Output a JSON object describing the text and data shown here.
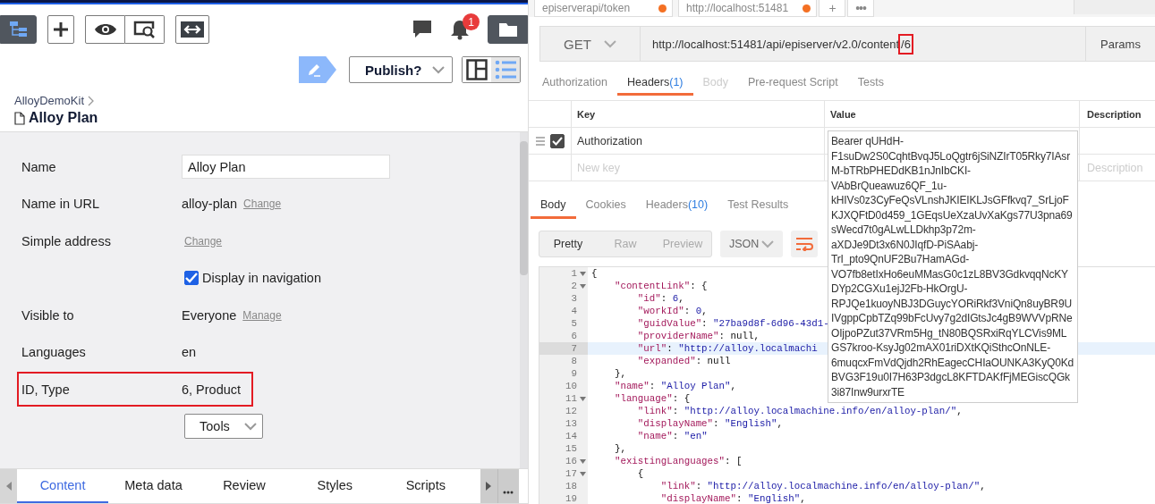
{
  "left": {
    "notification_count": "1",
    "publish_button": "Publish?",
    "view_toggle": [
      {
        "selected": false
      },
      {
        "selected": true
      }
    ],
    "breadcrumb": "AlloyDemoKit",
    "title": "Alloy Plan",
    "fields": [
      {
        "kind": "input",
        "label": "Name",
        "value": "Alloy Plan",
        "highlighted": false
      },
      {
        "kind": "text",
        "label": "Name in URL",
        "value": "alloy-plan",
        "link": "Change",
        "highlighted": false
      },
      {
        "kind": "text",
        "label": "Simple address",
        "link": "Change",
        "highlighted": false
      },
      {
        "kind": "checkbox",
        "value": "Display in navigation",
        "checked": true,
        "highlighted": false
      },
      {
        "kind": "text",
        "label": "Visible to",
        "value": "Everyone",
        "link": "Manage",
        "highlighted": false
      },
      {
        "kind": "text",
        "label": "Languages",
        "value": "en",
        "highlighted": false
      },
      {
        "kind": "text",
        "label": "ID, Type",
        "value": "6, Product",
        "highlighted": true
      },
      {
        "kind": "dropdown",
        "value": "Tools",
        "highlighted": false
      }
    ],
    "tabs": [
      {
        "label": "Content",
        "selected": true
      },
      {
        "label": "Meta data",
        "selected": false
      },
      {
        "label": "Review",
        "selected": false
      },
      {
        "label": "Styles",
        "selected": false
      },
      {
        "label": "Scripts",
        "selected": false
      }
    ]
  },
  "right": {
    "request_tabs": [
      {
        "label": "episerverapi/token",
        "unsaved": true
      },
      {
        "label": "http://localhost:51481",
        "unsaved": true
      }
    ],
    "add_tab": "+",
    "tab_menu": "•••",
    "method": "GET",
    "url": "http://localhost:51481/api/episerver/v2.0/content",
    "url_marked": "/6",
    "params_button": "Params",
    "request_sections": [
      {
        "label": "Authorization",
        "selected": false,
        "disabled": false
      },
      {
        "label": "Headers",
        "count": "(1)",
        "selected": true,
        "disabled": false
      },
      {
        "label": "Body",
        "selected": false,
        "disabled": true
      },
      {
        "label": "Pre-request Script",
        "selected": false,
        "disabled": false
      },
      {
        "label": "Tests",
        "selected": false,
        "disabled": false
      }
    ],
    "header_columns": [
      "Key",
      "Value",
      "Description"
    ],
    "headers": [
      {
        "key": "Authorization",
        "checked": true
      }
    ],
    "new_key_placeholder": "New key",
    "new_description_placeholder": "Description",
    "response_tabs": [
      {
        "label": "Body",
        "selected": true
      },
      {
        "label": "Cookies",
        "selected": false
      },
      {
        "label": "Headers",
        "count": "(10)",
        "selected": false
      },
      {
        "label": "Test Results",
        "selected": false
      }
    ],
    "view_modes": [
      {
        "label": "Pretty",
        "selected": true
      },
      {
        "label": "Raw",
        "selected": false
      },
      {
        "label": "Preview",
        "selected": false
      }
    ],
    "format": "JSON",
    "code_lines": [
      {
        "n": "1",
        "fold": true,
        "current": false,
        "segs": [
          {
            "kind": "punct",
            "text": "{"
          }
        ]
      },
      {
        "n": "2",
        "fold": true,
        "current": false,
        "segs": [
          {
            "kind": "key",
            "text": "    \"contentLink\""
          },
          {
            "kind": "punct",
            "text": ": {"
          }
        ]
      },
      {
        "n": "3",
        "fold": false,
        "current": false,
        "segs": [
          {
            "kind": "key",
            "text": "        \"id\""
          },
          {
            "kind": "punct",
            "text": ": "
          },
          {
            "kind": "number",
            "text": "6"
          },
          {
            "kind": "punct",
            "text": ","
          }
        ]
      },
      {
        "n": "4",
        "fold": false,
        "current": false,
        "segs": [
          {
            "kind": "key",
            "text": "        \"workId\""
          },
          {
            "kind": "punct",
            "text": ": "
          },
          {
            "kind": "number",
            "text": "0"
          },
          {
            "kind": "punct",
            "text": ","
          }
        ]
      },
      {
        "n": "5",
        "fold": false,
        "current": false,
        "segs": [
          {
            "kind": "key",
            "text": "        \"guidValue\""
          },
          {
            "kind": "punct",
            "text": ": "
          },
          {
            "kind": "string",
            "text": "\"27ba9d8f-6d96-43d1-"
          }
        ]
      },
      {
        "n": "6",
        "fold": false,
        "current": false,
        "segs": [
          {
            "kind": "key",
            "text": "        \"providerName\""
          },
          {
            "kind": "punct",
            "text": ": null,"
          }
        ]
      },
      {
        "n": "7",
        "fold": false,
        "current": true,
        "segs": [
          {
            "kind": "key",
            "text": "        \"url\""
          },
          {
            "kind": "punct",
            "text": ": "
          },
          {
            "kind": "string",
            "text": "\"http://alloy.localmachi"
          }
        ]
      },
      {
        "n": "8",
        "fold": false,
        "current": false,
        "segs": [
          {
            "kind": "key",
            "text": "        \"expanded\""
          },
          {
            "kind": "punct",
            "text": ": null"
          }
        ]
      },
      {
        "n": "9",
        "fold": false,
        "current": false,
        "segs": [
          {
            "kind": "punct",
            "text": "    },"
          }
        ]
      },
      {
        "n": "10",
        "fold": false,
        "current": false,
        "segs": [
          {
            "kind": "key",
            "text": "    \"name\""
          },
          {
            "kind": "punct",
            "text": ": "
          },
          {
            "kind": "string",
            "text": "\"Alloy Plan\""
          },
          {
            "kind": "punct",
            "text": ","
          }
        ]
      },
      {
        "n": "11",
        "fold": true,
        "current": false,
        "segs": [
          {
            "kind": "key",
            "text": "    \"language\""
          },
          {
            "kind": "punct",
            "text": ": {"
          }
        ]
      },
      {
        "n": "12",
        "fold": false,
        "current": false,
        "segs": [
          {
            "kind": "key",
            "text": "        \"link\""
          },
          {
            "kind": "punct",
            "text": ": "
          },
          {
            "kind": "string",
            "text": "\"http://alloy.localmachine.info/en/alloy-plan/\""
          },
          {
            "kind": "punct",
            "text": ","
          }
        ]
      },
      {
        "n": "13",
        "fold": false,
        "current": false,
        "segs": [
          {
            "kind": "key",
            "text": "        \"displayName\""
          },
          {
            "kind": "punct",
            "text": ": "
          },
          {
            "kind": "string",
            "text": "\"English\""
          },
          {
            "kind": "punct",
            "text": ","
          }
        ]
      },
      {
        "n": "14",
        "fold": false,
        "current": false,
        "segs": [
          {
            "kind": "key",
            "text": "        \"name\""
          },
          {
            "kind": "punct",
            "text": ": "
          },
          {
            "kind": "string",
            "text": "\"en\""
          }
        ]
      },
      {
        "n": "15",
        "fold": false,
        "current": false,
        "segs": [
          {
            "kind": "punct",
            "text": "    },"
          }
        ]
      },
      {
        "n": "16",
        "fold": true,
        "current": false,
        "segs": [
          {
            "kind": "key",
            "text": "    \"existingLanguages\""
          },
          {
            "kind": "punct",
            "text": ": ["
          }
        ]
      },
      {
        "n": "17",
        "fold": true,
        "current": false,
        "segs": [
          {
            "kind": "punct",
            "text": "        {"
          }
        ]
      },
      {
        "n": "18",
        "fold": false,
        "current": false,
        "segs": [
          {
            "kind": "key",
            "text": "            \"link\""
          },
          {
            "kind": "punct",
            "text": ": "
          },
          {
            "kind": "string",
            "text": "\"http://alloy.localmachine.info/en/alloy-plan/\""
          },
          {
            "kind": "punct",
            "text": ","
          }
        ]
      },
      {
        "n": "19",
        "fold": false,
        "current": false,
        "segs": [
          {
            "kind": "key",
            "text": "            \"displayName\""
          },
          {
            "kind": "punct",
            "text": ": "
          },
          {
            "kind": "string",
            "text": "\"English\""
          },
          {
            "kind": "punct",
            "text": ","
          }
        ]
      }
    ],
    "token_value": "Bearer qUHdH-F1suDw2S0CqhtBvqJ5LoQgtr6jSiNZIrT05Rky7IAsrM-bTRbPHEDdKB1nJnIbCKI-VAbBrQueawuz6QF_1u-kHIVs0z3CyFeQsVLnshJKIEIKLJsGFfkvq7_SrLjoFKJXQFtD0d459_1GEqsUeXzaUvXaKgs77U3pna69sWecd7t0gALwLLDkhp3p72m-aXDJe9Dt3x6N0JIqfD-PiSAabj-TrI_pto9QnUF2Bu7HamAGd-VO7fb8etIxHo6euMMasG0c1zL8BV3GdkvqqNcKYDYp2CGXu1ejJ2Fb-HkOrgU-RPJQe1kuoyNBJ3DGuycYORiRkf3VniQn8uyBR9UIVgppCpbTZq99bFcUvy7g2dIGtsJc4gB9WVVpRNeOIjpoPZut37VRm5Hg_tN80BQSRxiRqYLCVis9MLGS7kroo-KsyJg02mAX01riDXtKQiSthcOnNLE-6muqcxFmVdQjdh2RhEagecCHIaOUNKA3KyQ0KdBVG3F19u0I7H63P3dgcL8KFTDAKfFjMEGiscQGk3i87Inw9urxrTE"
  }
}
